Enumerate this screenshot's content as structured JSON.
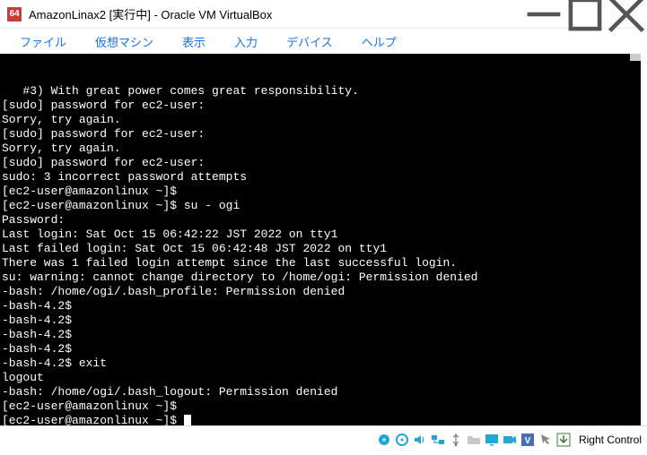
{
  "window": {
    "title": "AmazonLinax2 [実行中] - Oracle VM VirtualBox"
  },
  "menu": {
    "file": "ファイル",
    "machine": "仮想マシン",
    "view": "表示",
    "input": "入力",
    "devices": "デバイス",
    "help": "ヘルプ"
  },
  "terminal": {
    "lines": [
      "   #3) With great power comes great responsibility.",
      "",
      "[sudo] password for ec2-user:",
      "Sorry, try again.",
      "[sudo] password for ec2-user:",
      "Sorry, try again.",
      "[sudo] password for ec2-user:",
      "sudo: 3 incorrect password attempts",
      "[ec2-user@amazonlinux ~]$",
      "[ec2-user@amazonlinux ~]$ su - ogi",
      "Password:",
      "Last login: Sat Oct 15 06:42:22 JST 2022 on tty1",
      "Last failed login: Sat Oct 15 06:42:48 JST 2022 on tty1",
      "There was 1 failed login attempt since the last successful login.",
      "su: warning: cannot change directory to /home/ogi: Permission denied",
      "-bash: /home/ogi/.bash_profile: Permission denied",
      "-bash-4.2$",
      "-bash-4.2$",
      "-bash-4.2$",
      "-bash-4.2$",
      "-bash-4.2$ exit",
      "logout",
      "-bash: /home/ogi/.bash_logout: Permission denied",
      "[ec2-user@amazonlinux ~]$",
      "[ec2-user@amazonlinux ~]$ "
    ]
  },
  "statusbar": {
    "host_key": "Right Control"
  }
}
